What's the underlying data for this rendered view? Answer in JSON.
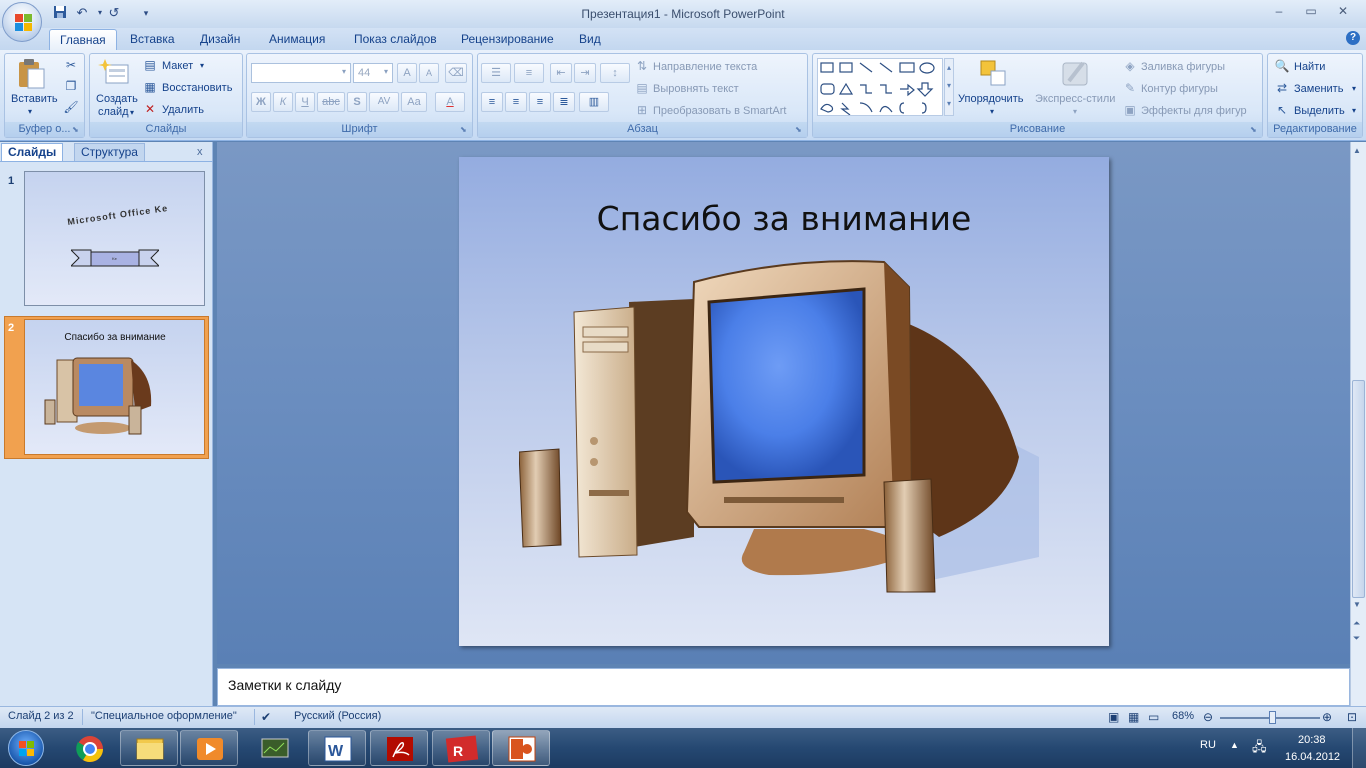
{
  "window": {
    "title": "Презентация1 - Microsoft PowerPoint"
  },
  "quick_access": {
    "save": "save-icon",
    "undo": "↶",
    "redo": "↺",
    "customize": "▾"
  },
  "tabs": [
    {
      "label": "Главная",
      "active": true
    },
    {
      "label": "Вставка"
    },
    {
      "label": "Дизайн"
    },
    {
      "label": "Анимация"
    },
    {
      "label": "Показ слайдов"
    },
    {
      "label": "Рецензирование"
    },
    {
      "label": "Вид"
    }
  ],
  "ribbon": {
    "clipboard": {
      "label": "Буфер о...",
      "paste": "Вставить"
    },
    "slides": {
      "label": "Слайды",
      "new_slide": "Создать",
      "new_slide2": "слайд",
      "layout": "Макет",
      "reset": "Восстановить",
      "delete": "Удалить"
    },
    "font": {
      "label": "Шрифт",
      "font_name": "",
      "font_size": "44",
      "bold": "Ж",
      "italic": "К",
      "underline": "Ч",
      "strike": "abc",
      "shadow": "S",
      "spacing": "AV",
      "case": "Aa",
      "color": "A",
      "grow": "A",
      "shrink": "A"
    },
    "paragraph": {
      "label": "Абзац",
      "text_direction": "Направление текста",
      "align_text": "Выровнять текст",
      "smartart": "Преобразовать в SmartArt"
    },
    "drawing": {
      "label": "Рисование",
      "arrange": "Упорядочить",
      "quick_styles": "Экспресс-стили",
      "fill": "Заливка фигуры",
      "outline": "Контур фигуры",
      "effects": "Эффекты для фигур"
    },
    "editing": {
      "label": "Редактирование",
      "find": "Найти",
      "replace": "Заменить",
      "select": "Выделить"
    }
  },
  "pane": {
    "tab_slides": "Слайды",
    "tab_outline": "Структура",
    "close": "x"
  },
  "thumbnails": [
    {
      "number": "1",
      "title": "Microsoft Office Ke",
      "banner": "Ke"
    },
    {
      "number": "2",
      "title": "Спасибо за внимание"
    }
  ],
  "slide": {
    "title": "Спасибо за внимание"
  },
  "notes": {
    "placeholder": "Заметки к слайду"
  },
  "status": {
    "slide_info": "Слайд 2 из 2",
    "theme": "\"Специальное оформление\"",
    "language": "Русский (Россия)",
    "zoom": "68%",
    "zoom_level": 0.68
  },
  "taskbar": {
    "language": "RU",
    "time": "20:38",
    "date": "16.04.2012"
  },
  "colors": {
    "accent": "#15428b",
    "ribbon": "#d3e3f6",
    "selected_thumb": "#f0a050"
  }
}
